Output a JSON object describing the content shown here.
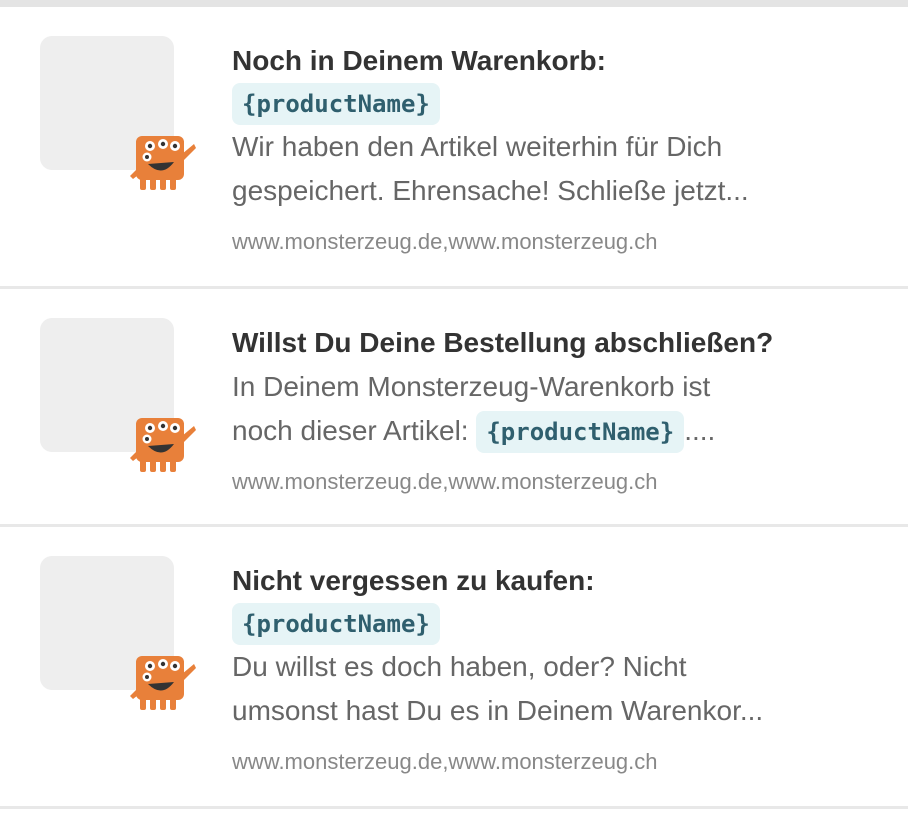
{
  "notifications": [
    {
      "title": "Noch in Deinem Warenkorb:",
      "placeholder": "{productName}",
      "line1": "Wir haben den Artikel weiterhin für Dich",
      "line2": "gespeichert. Ehrensache! Schließe jetzt...",
      "url": "www.monsterzeug.de,www.monsterzeug.ch"
    },
    {
      "title": "Willst Du Deine Bestellung abschließen?",
      "line1": "In Deinem Monsterzeug-Warenkorb ist",
      "line2_prefix": "noch dieser Artikel:",
      "placeholder": "{productName}",
      "line2_suffix": "....",
      "url": "www.monsterzeug.de,www.monsterzeug.ch"
    },
    {
      "title": "Nicht vergessen zu kaufen:",
      "placeholder": "{productName}",
      "line1": "Du willst es doch haben, oder? Nicht",
      "line2": "umsonst hast Du es in Deinem Warenkor...",
      "url": "www.monsterzeug.de,www.monsterzeug.ch"
    }
  ],
  "icon": "monster-logo-icon",
  "colors": {
    "monster": "#e8803a",
    "code_bg": "#e6f4f6",
    "code_text": "#2f5f6e"
  }
}
